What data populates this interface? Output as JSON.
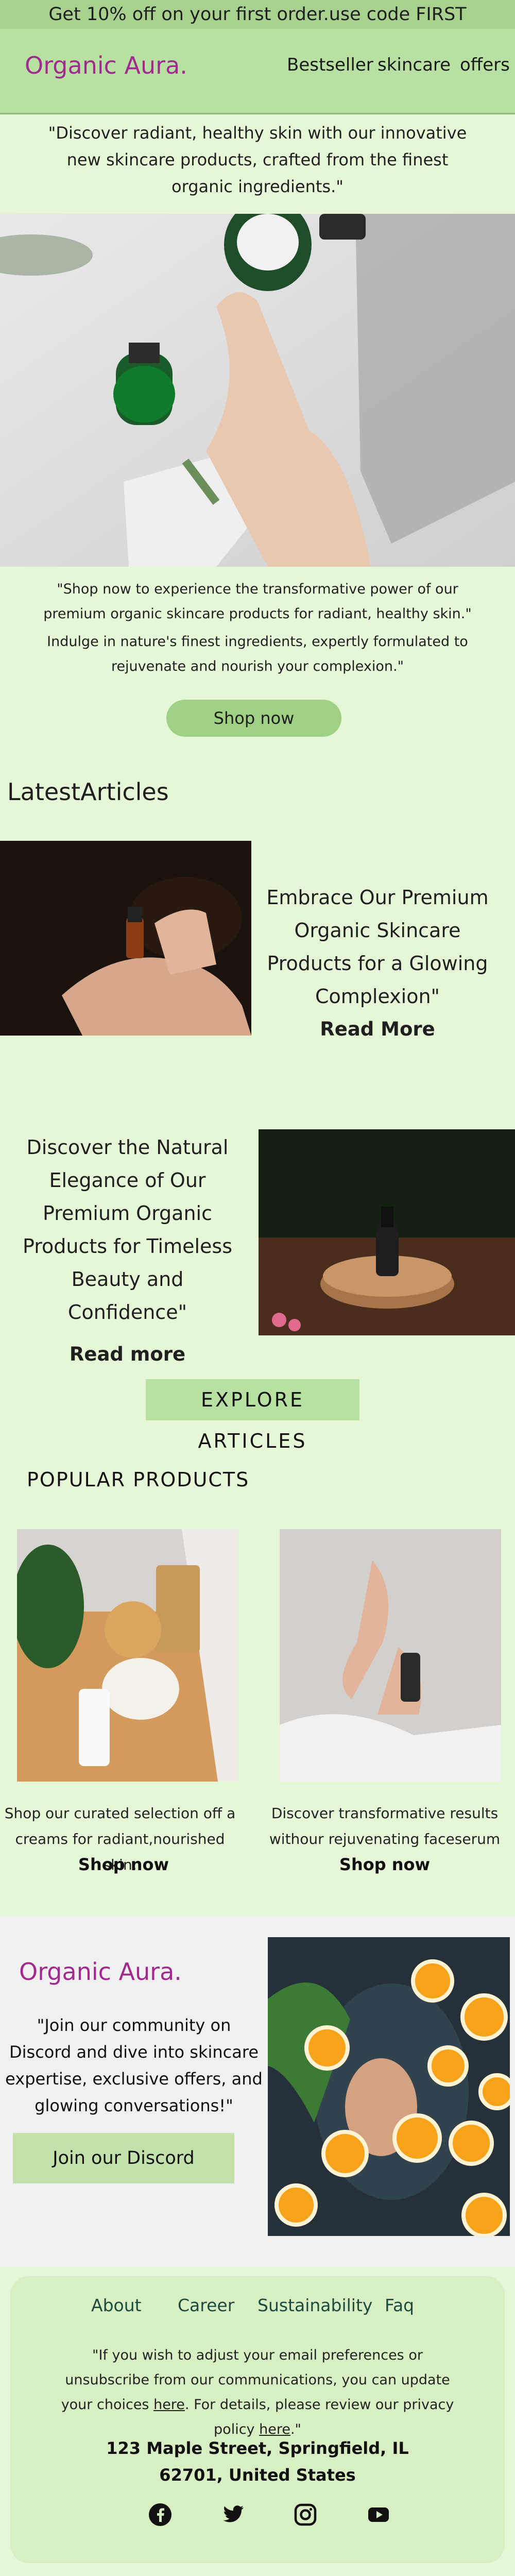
{
  "promo_bar": {
    "text": "Get 10% off on your first order.use code FIRST"
  },
  "header": {
    "logo": "Organic Aura.",
    "nav": [
      {
        "label": "Bestseller"
      },
      {
        "label": "skincare"
      },
      {
        "label": "offers"
      }
    ]
  },
  "intro": {
    "text": "\"Discover radiant, healthy skin with our innovative new skincare products, crafted from the finest organic ingredients.\""
  },
  "hero": {
    "text_line1": "\"Shop now to experience the transformative power of our premium organic skincare products for radiant, healthy skin.\"",
    "text_line2": "Indulge in nature's finest ingredients, expertly formulated to rejuvenate and nourish your complexion.\"",
    "cta": "Shop now"
  },
  "latest_articles": {
    "title": "LatestArticles",
    "articles": [
      {
        "text": "Embrace Our Premium Organic Skincare Products for a Glowing Complexion\"",
        "cta": "Read More"
      },
      {
        "text": "Discover the Natural Elegance of Our Premium Organic Products for Timeless Beauty and Confidence\"",
        "cta": "Read more"
      }
    ],
    "explore": "EXPLORE ARTICLES"
  },
  "popular": {
    "title": "POPULAR PRODUCTS",
    "products": [
      {
        "desc": "Shop our curated selection off a creams for radiant,nourished skin.",
        "cta": "Shop now"
      },
      {
        "desc": "Discover transformative results withour rejuvenating faceserum",
        "cta": "Shop now"
      }
    ]
  },
  "community": {
    "logo": "Organic Aura.",
    "text": "\"Join our community on Discord and dive into skincare expertise, exclusive offers, and glowing conversations!\"",
    "cta": "Join our Discord"
  },
  "footer": {
    "links": [
      {
        "label": "About"
      },
      {
        "label": "Career"
      },
      {
        "label": "Sustainability"
      },
      {
        "label": "Faq"
      }
    ],
    "prefs_part1": "\"If you wish to adjust your email preferences or unsubscribe from our communications, you can update your choices ",
    "prefs_link": "here",
    "prefs_part2": ". For details, please review our privacy policy ",
    "prefs_link2": "here",
    "prefs_part3": ".\"",
    "address": "123 Maple Street, Springfield, IL 62701, United States",
    "social": [
      {
        "icon": "facebook-icon"
      },
      {
        "icon": "twitter-icon"
      },
      {
        "icon": "instagram-icon"
      },
      {
        "icon": "youtube-icon"
      }
    ]
  },
  "colors": {
    "background": "#e6f7d7",
    "promo": "#a8d18f",
    "brand": "#a12a8f",
    "button": "#9fd083"
  }
}
